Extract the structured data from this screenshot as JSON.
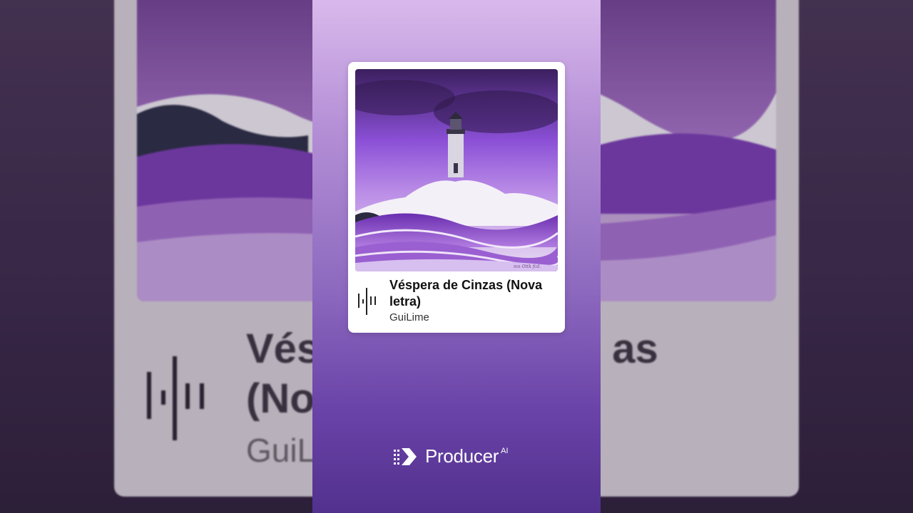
{
  "song": {
    "title": "Véspera de Cinzas (Nova letra)",
    "artist": "GuiLime"
  },
  "background": {
    "title_fragment_1": "Vés",
    "title_fragment_2": "as",
    "title_fragment_3": "(No",
    "artist_fragment": "GuiL"
  },
  "brand": {
    "name": "Producer",
    "suffix": "AI"
  },
  "icons": {
    "waveform": "audio-waveform-icon",
    "logo": "producer-logo-icon"
  },
  "colors": {
    "panel_top": "#d9b9ec",
    "panel_bottom": "#52318e",
    "accent_purple": "#8a4fd6"
  }
}
